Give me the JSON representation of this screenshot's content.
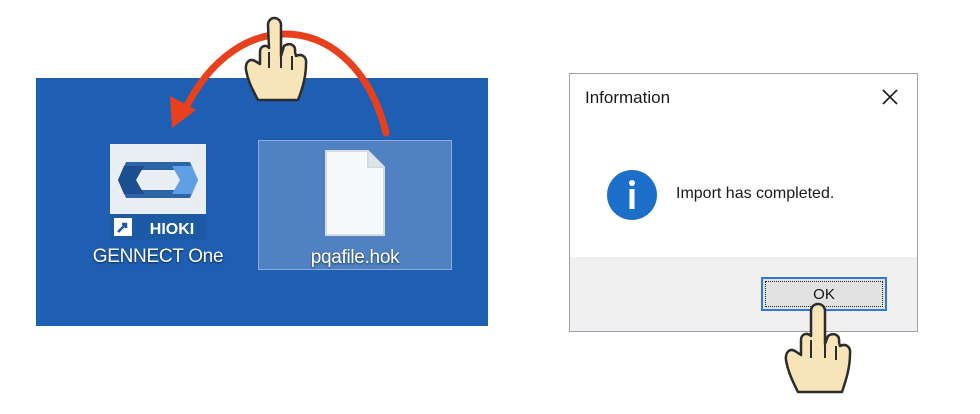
{
  "desktop": {
    "background": "#1f5fb3",
    "icons": [
      {
        "label": "GENNECT One",
        "icon": "gennect-one-app-icon",
        "brand_text": "HIOKI"
      },
      {
        "label": "pqafile.hok",
        "icon": "document-file-icon",
        "selected": true
      }
    ]
  },
  "dialog": {
    "title": "Information",
    "message": "Import has completed.",
    "icon": "info-icon",
    "ok_label": "OK"
  },
  "annotations": {
    "arrow": {
      "icon": "curved-arrow-icon",
      "color": "#e8401c"
    },
    "hands": [
      "pointing-hand-icon",
      "pointing-hand-icon"
    ]
  }
}
